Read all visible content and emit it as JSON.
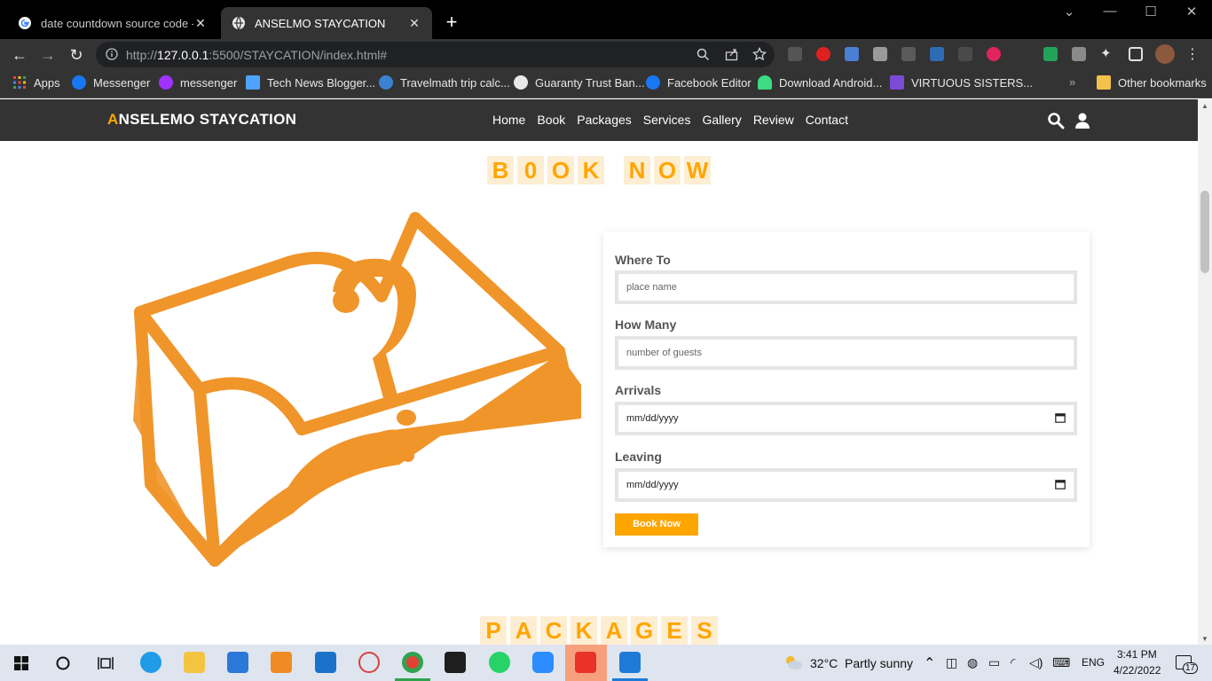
{
  "browser": {
    "tabs": [
      {
        "title": "date countdown source code - G",
        "active": false
      },
      {
        "title": "ANSELMO STAYCATION",
        "active": true
      }
    ],
    "url_host": "127.0.0.1",
    "url_rest": ":5500/STAYCATION/index.html#",
    "url_prefix": "http://",
    "bookmarks": [
      {
        "label": "Apps",
        "color": "#ea4335"
      },
      {
        "label": "Messenger",
        "color": "#1877f2"
      },
      {
        "label": "messenger",
        "color": "#a033ff"
      },
      {
        "label": "Tech News Blogger...",
        "color": "#4da3ff"
      },
      {
        "label": "Travelmath trip calc...",
        "color": "#3b82d1"
      },
      {
        "label": "Guaranty Trust Ban...",
        "color": "#e8e8e8"
      },
      {
        "label": "Facebook Editor",
        "color": "#1877f2"
      },
      {
        "label": "Download Android...",
        "color": "#3ddc84"
      },
      {
        "label": "VIRTUOUS SISTERS...",
        "color": "#7b4bd6"
      }
    ],
    "other_bookmarks": "Other bookmarks"
  },
  "site": {
    "logo_first": "A",
    "logo_rest": "NSELEMO STAYCATION",
    "nav": [
      "Home",
      "Book",
      "Packages",
      "Services",
      "Gallery",
      "Review",
      "Contact"
    ],
    "accent": "#ffa500",
    "book_heading": [
      "B",
      "0",
      "O",
      "K",
      " ",
      "N",
      "O",
      "W"
    ],
    "packages_heading": [
      "P",
      "A",
      "C",
      "K",
      "A",
      "G",
      "E",
      "S"
    ]
  },
  "form": {
    "where_label": "Where To",
    "where_placeholder": "place name",
    "how_label": "How Many",
    "how_placeholder": "number of guests",
    "arrivals_label": "Arrivals",
    "arrivals_value": "mm/dd/yyyy",
    "leaving_label": "Leaving",
    "leaving_value": "mm/dd/yyyy",
    "submit_label": "Book Now"
  },
  "taskbar": {
    "weather_temp": "32°C",
    "weather_desc": "Partly sunny",
    "language": "ENG",
    "time": "3:41 PM",
    "date": "4/22/2022",
    "notifications": "17"
  }
}
